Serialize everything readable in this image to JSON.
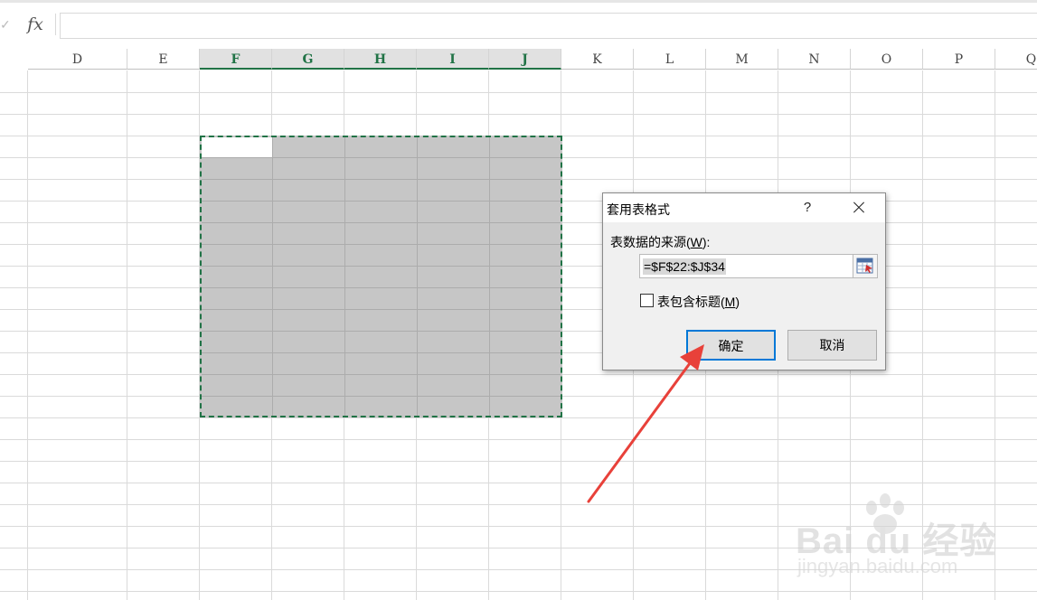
{
  "formula_bar": {
    "fx_label": "fx",
    "left_glyph": "✓",
    "value": ""
  },
  "sheet": {
    "columns": [
      {
        "label": "D",
        "selected": false
      },
      {
        "label": "E",
        "selected": false
      },
      {
        "label": "F",
        "selected": true
      },
      {
        "label": "G",
        "selected": true
      },
      {
        "label": "H",
        "selected": true
      },
      {
        "label": "I",
        "selected": true
      },
      {
        "label": "J",
        "selected": true
      },
      {
        "label": "K",
        "selected": false
      },
      {
        "label": "L",
        "selected": false
      },
      {
        "label": "M",
        "selected": false
      },
      {
        "label": "N",
        "selected": false
      },
      {
        "label": "O",
        "selected": false
      },
      {
        "label": "P",
        "selected": false
      },
      {
        "label": "Q",
        "selected": false
      }
    ],
    "selection_color": "#217346"
  },
  "dialog": {
    "title": "套用表格式",
    "help": "?",
    "source_label_prefix": "表数据的来源(",
    "source_label_key": "W",
    "source_label_suffix": "):",
    "source_value": "=$F$22:$J$34",
    "header_checkbox_prefix": "表包含标题(",
    "header_checkbox_key": "M",
    "header_checkbox_suffix": ")",
    "header_checked": false,
    "ok_label": "确定",
    "cancel_label": "取消"
  },
  "watermark": {
    "main": "Bai du 经验",
    "sub": "jingyan.baidu.com"
  },
  "colors": {
    "accent": "#217346",
    "focus": "#0078d7",
    "arrow": "#e8413a"
  }
}
